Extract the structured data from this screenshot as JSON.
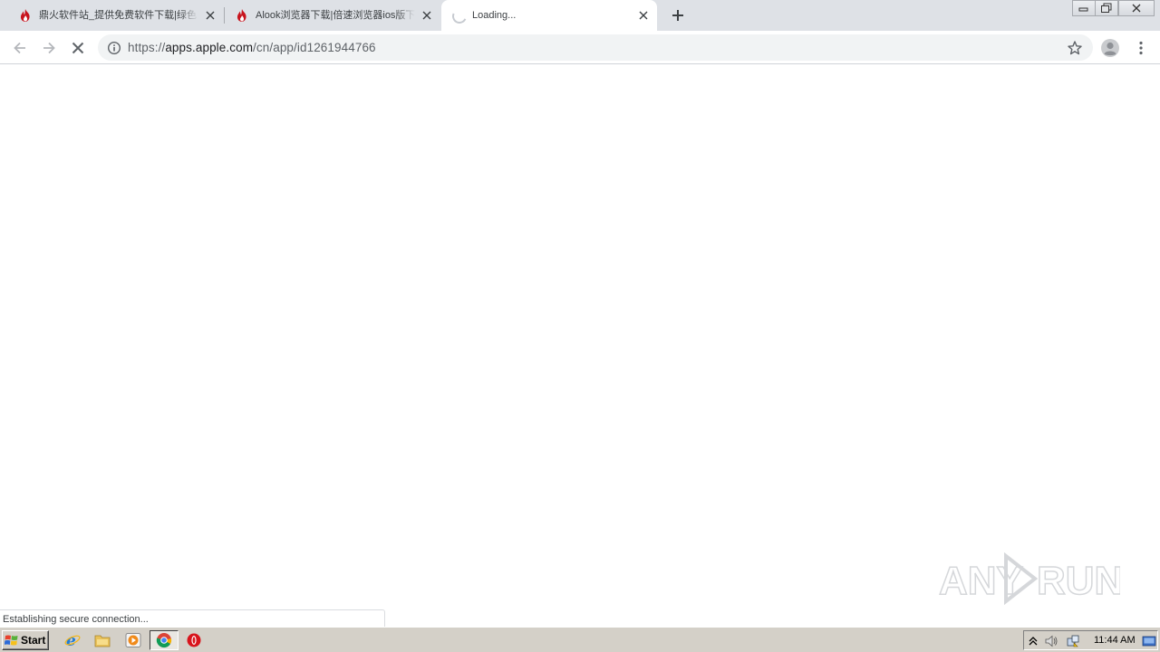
{
  "browser": {
    "tabs": [
      {
        "title": "鼎火软件站_提供免费软件下载|绿色",
        "favicon": "flame-icon",
        "state": "inactive"
      },
      {
        "title": "Alook浏览器下载|倍速浏览器ios版下",
        "favicon": "flame-icon",
        "state": "inactive"
      },
      {
        "title": "Loading...",
        "favicon": "loading-spinner-icon",
        "state": "active"
      }
    ],
    "new_tab_icon": "plus-icon",
    "window_controls": [
      "minimize-icon",
      "restore-icon",
      "close-icon"
    ],
    "toolbar": {
      "back_icon": "back-arrow-icon",
      "forward_icon": "forward-arrow-icon",
      "stop_icon": "stop-icon",
      "url_scheme": "https://",
      "url_host": "apps.apple.com",
      "url_path": "/cn/app/id1261944766",
      "bookmark_icon": "star-icon",
      "profile_icon": "avatar-icon",
      "menu_icon": "kebab-menu-icon"
    },
    "status_text": "Establishing secure connection...",
    "watermark": "ANY RUN"
  },
  "taskbar": {
    "start_label": "Start",
    "quick_launch": [
      "ie-icon",
      "folder-icon",
      "media-player-icon",
      "chrome-icon",
      "opera-icon"
    ],
    "clock": "11:44 AM",
    "tray_icons": [
      "chevron-up-icon",
      "volume-icon",
      "network-icon",
      "show-desktop-icon"
    ]
  },
  "colors": {
    "tabstrip": "#dee1e6",
    "omnibox": "#f1f3f4",
    "taskbar": "#d4d0c8",
    "favicon_red": "#c8141e"
  }
}
